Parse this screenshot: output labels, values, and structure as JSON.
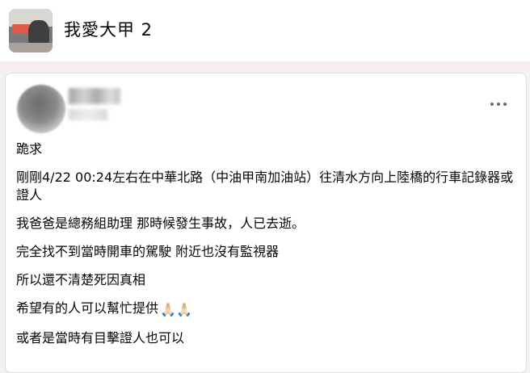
{
  "group": {
    "name": "我愛大甲 2"
  },
  "post": {
    "more_icon": "more-horizontal-icon",
    "paragraphs": [
      "跪求",
      "剛剛4/22 00:24左右在中華北路（中油甲南加油站）往清水方向上陸橋的行車記錄器或證人",
      "我爸爸是總務組助理 那時候發生事故，人已去逝。",
      "完全找不到當時開車的駕駛 附近也沒有監視器",
      "所以還不清楚死因真相",
      "希望有的人可以幫忙提供",
      "或者是當時有目擊證人也可以"
    ],
    "emoji": "🙏🏻🙏🏻"
  },
  "colors": {
    "page_bg": "#f0f2f5",
    "text": "#050505",
    "icon_gray": "#65676b"
  }
}
